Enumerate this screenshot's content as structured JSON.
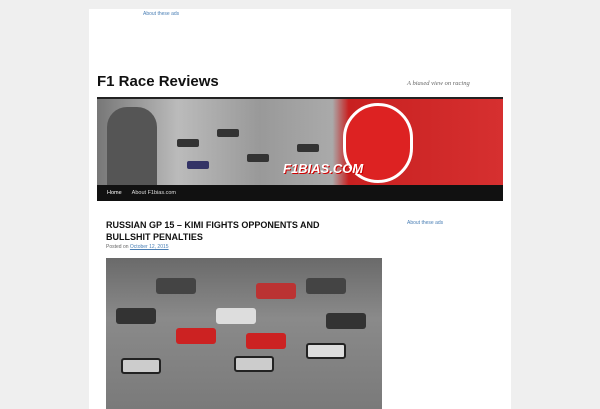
{
  "ads": {
    "top_label": "About these ads",
    "side_label": "About these ads"
  },
  "site": {
    "title": "F1 Race Reviews",
    "tagline": "A biased view on racing",
    "banner_logo": "F1BIAS.COM"
  },
  "nav": {
    "items": [
      {
        "label": "Home"
      },
      {
        "label": "About F1bias.com"
      }
    ]
  },
  "post": {
    "title": "RUSSIAN GP 15 – KIMI FIGHTS OPPONENTS AND BULLSHIT PENALTIES",
    "posted_prefix": "Posted on",
    "date": "October 12, 2015"
  }
}
